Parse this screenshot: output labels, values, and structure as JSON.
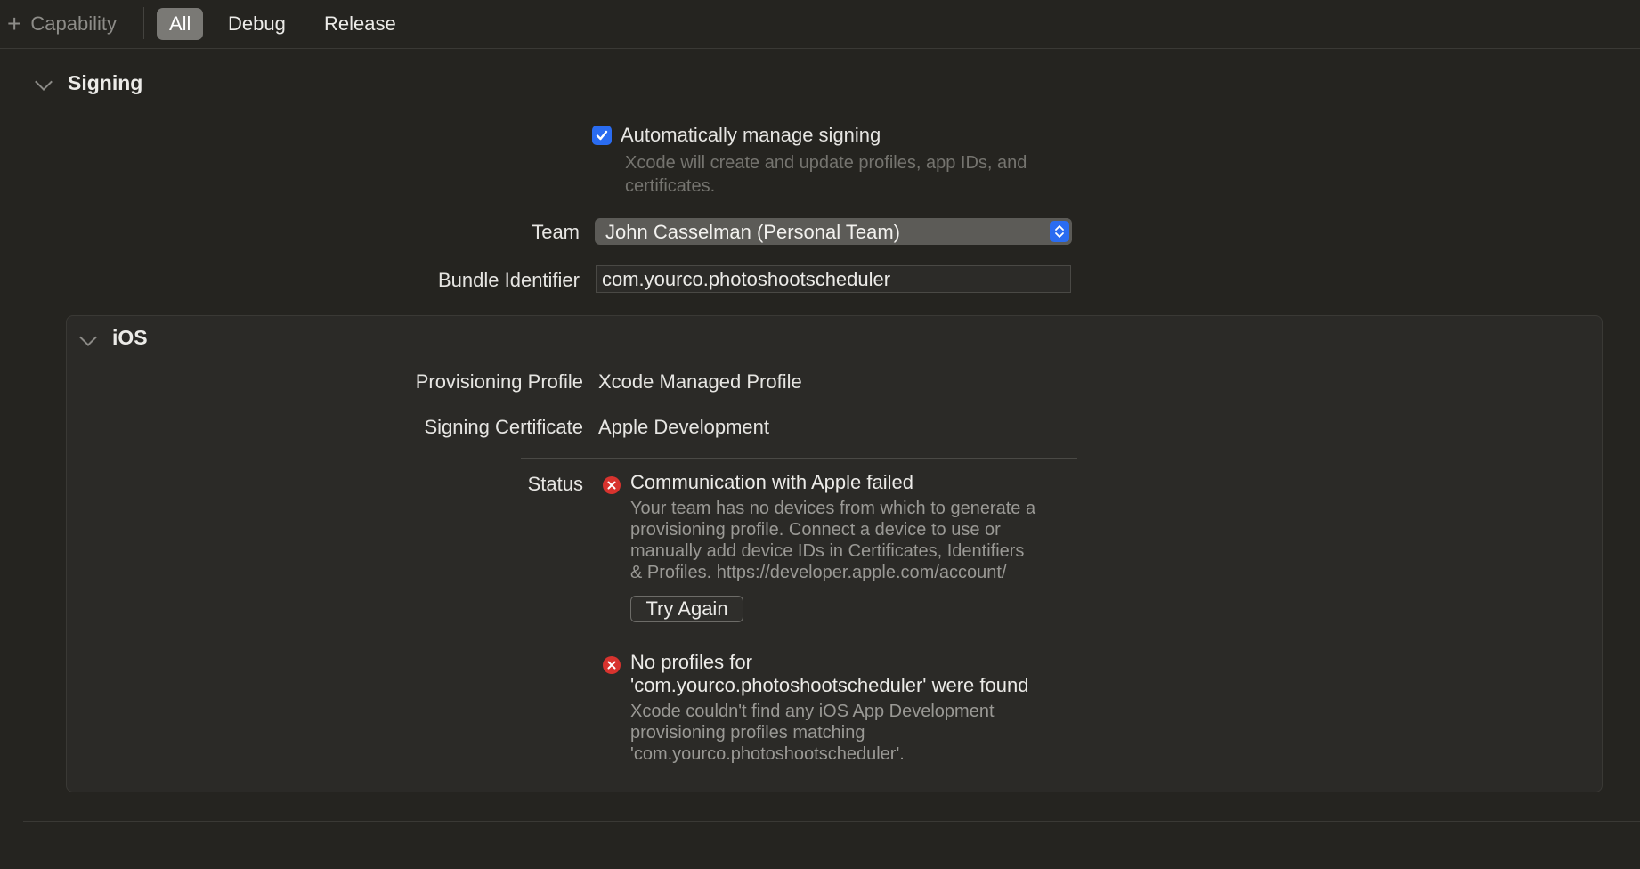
{
  "toolbar": {
    "capability_label": "Capability",
    "tabs": [
      {
        "label": "All",
        "active": true
      },
      {
        "label": "Debug",
        "active": false
      },
      {
        "label": "Release",
        "active": false
      }
    ]
  },
  "signing": {
    "title": "Signing",
    "auto_manage": {
      "label": "Automatically manage signing",
      "checked": true,
      "description_line1": "Xcode will create and update profiles, app IDs, and",
      "description_line2": "certificates."
    },
    "team": {
      "label": "Team",
      "value": "John Casselman (Personal Team)"
    },
    "bundle_identifier": {
      "label": "Bundle Identifier",
      "value": "com.yourco.photoshootscheduler"
    }
  },
  "ios": {
    "title": "iOS",
    "provisioning_profile": {
      "label": "Provisioning Profile",
      "value": "Xcode Managed Profile"
    },
    "signing_certificate": {
      "label": "Signing Certificate",
      "value": "Apple Development"
    },
    "status": {
      "label": "Status",
      "errors": [
        {
          "title_line1": "Communication with Apple failed",
          "title_line2": "",
          "body_line1": "Your team has no devices from which to generate a",
          "body_line2": "provisioning profile. Connect a device to use or",
          "body_line3": "manually add device IDs in Certificates, Identifiers",
          "body_line4": "& Profiles. https://developer.apple.com/account/"
        },
        {
          "title_line1": "No profiles for",
          "title_line2": "'com.yourco.photoshootscheduler' were found",
          "body_line1": "Xcode couldn't find any iOS App Development",
          "body_line2": "provisioning profiles matching",
          "body_line3": "'com.yourco.photoshootscheduler'.",
          "body_line4": ""
        }
      ],
      "try_again_label": "Try Again"
    }
  },
  "colors": {
    "background": "#252420",
    "accent_blue": "#2a6cf1",
    "error_red": "#d8332e"
  },
  "icons": [
    "plus-icon",
    "chevron-down-icon",
    "checkmark-icon",
    "popup-stepper-icon",
    "error-x-icon"
  ]
}
